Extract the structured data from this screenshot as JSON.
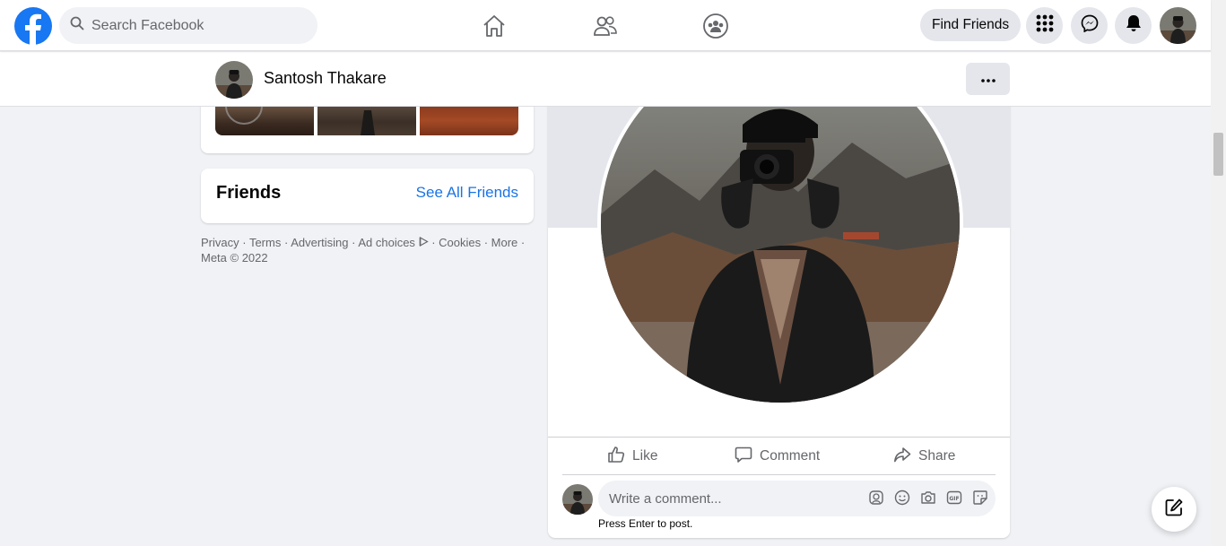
{
  "topbar": {
    "search_placeholder": "Search Facebook",
    "find_friends_label": "Find Friends",
    "icons": [
      "facebook-logo",
      "home-icon",
      "friends-icon",
      "groups-icon",
      "menu-grid-icon",
      "messenger-icon",
      "notifications-icon"
    ]
  },
  "profile_bar": {
    "name": "Santosh Thakare",
    "more_label": "···"
  },
  "friends_card": {
    "title": "Friends",
    "see_all": "See All Friends"
  },
  "footer": {
    "privacy": "Privacy",
    "terms": "Terms",
    "advertising": "Advertising",
    "ad_choices": "Ad choices",
    "cookies": "Cookies",
    "more": "More",
    "copyright": "Meta © 2022"
  },
  "post": {
    "like": "Like",
    "comment": "Comment",
    "share": "Share",
    "comment_placeholder": "Write a comment...",
    "press_enter": "Press Enter to post."
  },
  "colors": {
    "brand": "#1877f2",
    "link": "#1b74e4",
    "background": "#f0f2f5"
  }
}
